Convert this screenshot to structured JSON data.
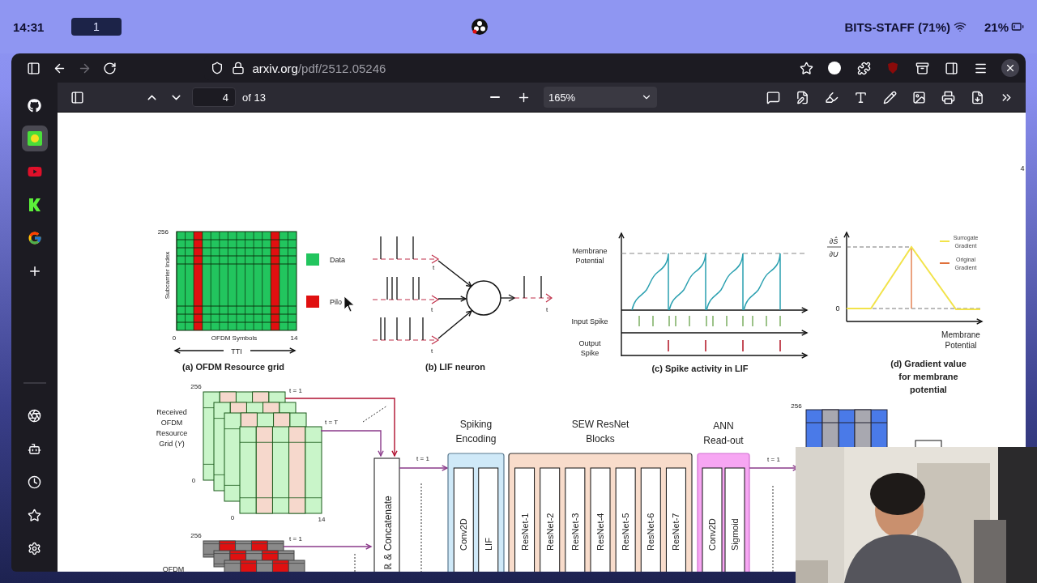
{
  "top_bar": {
    "time": "14:31",
    "workspace": "1",
    "network": "BITS-STAFF (71%)",
    "battery": "21%"
  },
  "browser": {
    "url_host": "arxiv.org",
    "url_path": "/pdf/2512.05246",
    "forward_disabled": true
  },
  "sidebar": {
    "items": [
      {
        "selected": false
      },
      {
        "selected": true
      },
      {
        "selected": false
      },
      {
        "selected": false
      },
      {
        "selected": false
      }
    ]
  },
  "pdf_toolbar": {
    "page": "4",
    "page_count": "of 13",
    "zoom": "165%"
  },
  "page": {
    "page_number": "4"
  },
  "figure": {
    "grid_panel": {
      "y_max": "256",
      "y_label": "Subcarrier Index",
      "x_min": "0",
      "x_label": "OFDM Symbols",
      "x_max": "14",
      "span_label": "TTI",
      "legend": [
        {
          "label": "Data",
          "color": "#22c55e"
        },
        {
          "label": "Pilo",
          "color": "#e01010"
        }
      ],
      "caption": "(a) OFDM Resource grid"
    },
    "neuron_panel": {
      "time_labels": [
        "t",
        "t",
        "t",
        "t"
      ],
      "caption": "(b) LIF neuron"
    },
    "spike_panel": {
      "row_labels": [
        [
          "Membrane",
          "Potential"
        ],
        [
          "Input Spike"
        ],
        [
          "Output",
          "Spike"
        ]
      ],
      "caption": "(c) Spike activity in LIF"
    },
    "gradient_panel": {
      "numerator": "∂Ŝ",
      "denominator": "∂U",
      "zero": "0",
      "legend": [
        {
          "lines": [
            "Surrogate",
            "Gradient"
          ],
          "color": "#f2e34a"
        },
        {
          "lines": [
            "Original",
            "Gradient"
          ],
          "color": "#e0703a"
        }
      ],
      "x_label": [
        "Membrane",
        "Potential"
      ],
      "caption": [
        "(d) Gradient value",
        "for membrane",
        "potential"
      ]
    },
    "pipeline": {
      "input_grid": {
        "y_max": "256",
        "first_step": "t = 1",
        "last_step": "t = T",
        "label": "Received OFDM Resource Grid (*Y*)",
        "x_min_back": "0",
        "x_min": "0",
        "x_max": "14"
      },
      "pilot_grid": {
        "y_max": "256",
        "first_step": "t = 1",
        "label": "OFDM"
      },
      "concat": "ℝ & Concatenate",
      "step_labels": [
        "t = 1",
        "t = 1"
      ],
      "blocks": [
        {
          "kind": "encoding",
          "title": [
            "Spiking",
            "Encoding"
          ],
          "layers": [
            "Conv2D",
            "LIF"
          ]
        },
        {
          "kind": "resnet",
          "title": [
            "SEW ResNet",
            "Blocks"
          ],
          "layers": [
            "ResNet-1",
            "ResNet-2",
            "ResNet-3",
            "ResNet-4",
            "ResNet-5",
            "ResNet-6",
            "ResNet-7"
          ]
        },
        {
          "kind": "readout",
          "title": [
            "ANN",
            "Read-out"
          ],
          "layers": [
            "Conv2D",
            "Sigmoid"
          ]
        }
      ],
      "output_grid": {
        "y_max": "256"
      }
    }
  }
}
